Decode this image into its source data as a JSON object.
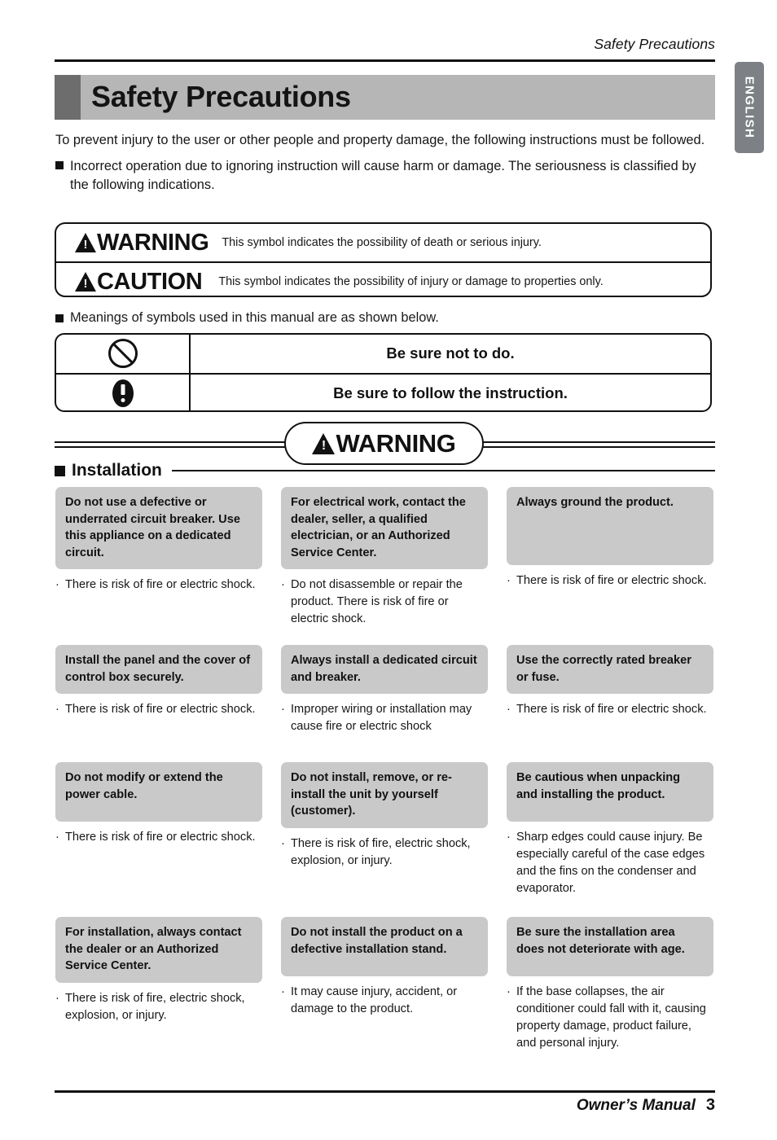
{
  "running_head": "Safety Precautions",
  "lang_tab": "ENGLISH",
  "page_title": "Safety Precautions",
  "intro": {
    "paragraph": "To prevent injury to the user or other people and property damage, the following instructions must be followed.",
    "bullet": "Incorrect operation due to ignoring instruction will cause harm or damage. The seriousness is classified by the following indications."
  },
  "definitions": {
    "warning_label": "WARNING",
    "warning_desc": "This symbol indicates the possibility of death or serious injury.",
    "caution_label": "CAUTION",
    "caution_desc": "This symbol indicates the possibility of injury or damage to properties only."
  },
  "meanings_line": "Meanings of symbols used in this manual are as shown below.",
  "symbols": [
    {
      "icon": "prohibition-icon",
      "text": "Be sure not to do."
    },
    {
      "icon": "mandatory-icon",
      "text": "Be sure to follow the instruction."
    }
  ],
  "banner": {
    "label": "WARNING"
  },
  "section": {
    "label": "Installation"
  },
  "bullet_mark": "·",
  "items": [
    {
      "title": "Do not use a defective or underrated circuit breaker. Use this appliance on a dedicated circuit.",
      "note": "There is risk of fire or electric shock."
    },
    {
      "title": "For electrical work, contact the dealer, seller, a qualified electrician, or an Authorized Service Center.",
      "note": "Do not disassemble or repair the product. There is risk of fire or electric shock."
    },
    {
      "title": "Always ground the product.",
      "note": "There is risk of fire or electric shock."
    },
    {
      "title": "Install the panel and the cover of control box securely.",
      "note": "There is risk of fire or electric shock."
    },
    {
      "title": "Always install a dedicated circuit and breaker.",
      "note": "Improper wiring or installation may cause fire or electric shock"
    },
    {
      "title": "Use the correctly rated breaker or fuse.",
      "note": "There is risk of fire or electric shock."
    },
    {
      "title": "Do not modify or extend the power cable.",
      "note": "There is risk of fire or electric shock."
    },
    {
      "title": "Do not install, remove, or re-install the unit by yourself (customer).",
      "note": "There is risk of fire, electric shock, explosion, or injury."
    },
    {
      "title": "Be cautious when unpacking and installing  the product.",
      "note": "Sharp edges could cause injury. Be especially careful of the case edges and the fins on the condenser and evaporator."
    },
    {
      "title": "For installation, always contact the dealer or an Authorized Service Center.",
      "note": "There is risk of fire, electric shock, explosion, or injury."
    },
    {
      "title": "Do not install the product on a defective installation stand.",
      "note": "It may cause injury, accident, or damage to the product."
    },
    {
      "title": "Be sure the installation area does not deteriorate with age.",
      "note": "If the base collapses, the air conditioner could fall with it, causing property damage, product failure, and personal injury."
    }
  ],
  "footer": {
    "manual": "Owner’s Manual",
    "page_number": "3"
  },
  "colors": {
    "title_band": "#b6b6b6",
    "title_tick": "#6d6d6d",
    "lang_tab": "#7d8084",
    "item_header": "#c9c9c9",
    "ink": "#111111"
  }
}
